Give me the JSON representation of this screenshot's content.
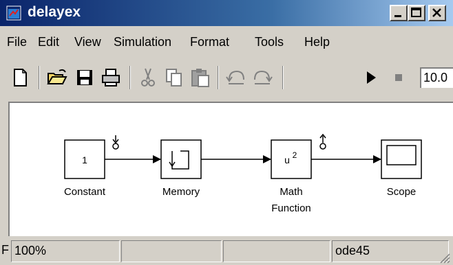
{
  "window": {
    "title": "delayex"
  },
  "menu": [
    "File",
    "Edit",
    "View",
    "Simulation",
    "Format",
    "Tools",
    "Help"
  ],
  "toolbar": {
    "stop_time": "10.0"
  },
  "blocks": {
    "constant": {
      "value": "1",
      "label": "Constant"
    },
    "memory": {
      "label": "Memory"
    },
    "math": {
      "exp": "u",
      "sup": "2",
      "label1": "Math",
      "label2": "Function"
    },
    "scope": {
      "label": "Scope"
    }
  },
  "status": {
    "prefix": "F",
    "zoom": "100%",
    "solver": "ode45"
  },
  "colors": {
    "title_start": "#0a246a",
    "title_end": "#a6caf0",
    "chrome": "#d4d0c8"
  }
}
